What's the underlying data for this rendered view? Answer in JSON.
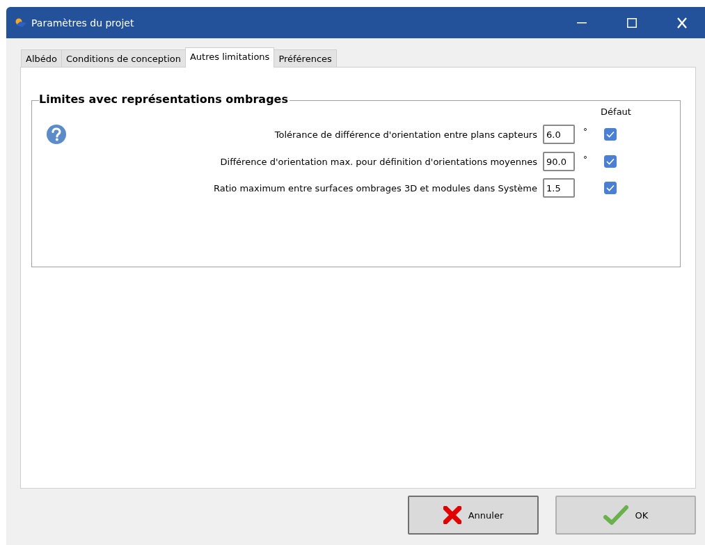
{
  "window": {
    "title": "Paramètres du projet"
  },
  "tabs": [
    {
      "label": "Albédo",
      "selected": false
    },
    {
      "label": "Conditions de conception",
      "selected": false
    },
    {
      "label": "Autres limitations",
      "selected": true
    },
    {
      "label": "Préférences",
      "selected": false
    }
  ],
  "group": {
    "title": "Limites avec représentations ombrages",
    "default_header": "Défaut",
    "rows": [
      {
        "label": "Tolérance de différence d'orientation entre plans capteurs",
        "value": "6.0",
        "unit": "°",
        "checked": true
      },
      {
        "label": "Différence d'orientation max. pour définition d'orientations moyennes",
        "value": "90.0",
        "unit": "°",
        "checked": true
      },
      {
        "label": "Ratio maximum entre surfaces ombrages 3D et modules dans Système",
        "value": "1.5",
        "checked": true
      }
    ]
  },
  "buttons": [
    {
      "kind": "cancel",
      "label": "Annuler"
    },
    {
      "kind": "ok",
      "label": "OK"
    }
  ]
}
